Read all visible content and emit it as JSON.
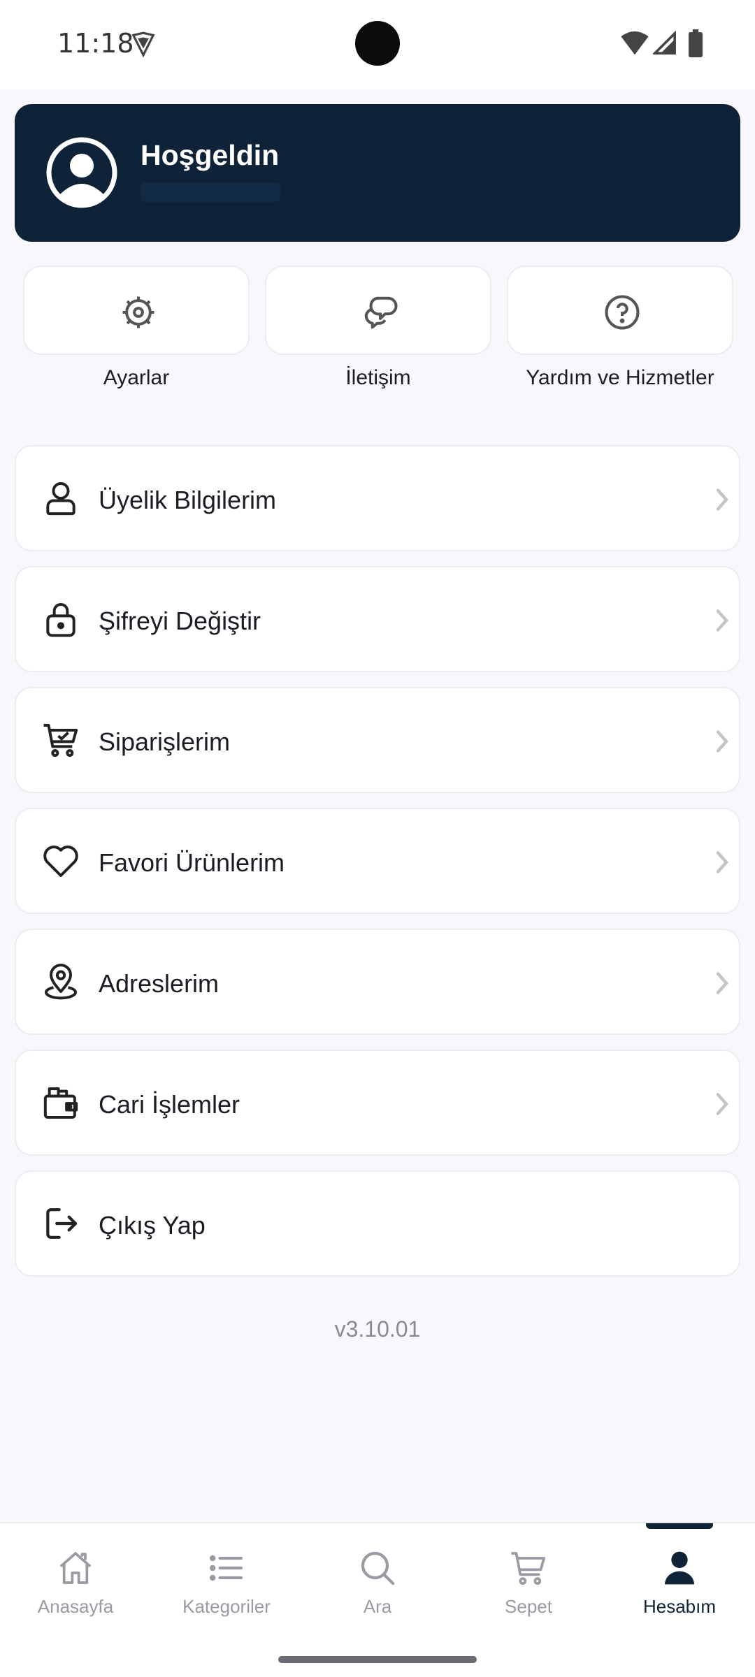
{
  "status_bar": {
    "time": "11:18"
  },
  "header": {
    "welcome_title": "Hoşgeldin"
  },
  "quick_actions": [
    {
      "label": "Ayarlar",
      "icon": "gear-icon"
    },
    {
      "label": "İletişim",
      "icon": "chat-bubbles-icon"
    },
    {
      "label": "Yardım ve Hizmetler",
      "icon": "help-circle-icon"
    }
  ],
  "menu": [
    {
      "label": "Üyelik Bilgilerim",
      "icon": "user-icon",
      "has_chevron": true
    },
    {
      "label": "Şifreyi Değiştir",
      "icon": "lock-icon",
      "has_chevron": true
    },
    {
      "label": "Siparişlerim",
      "icon": "cart-check-icon",
      "has_chevron": true
    },
    {
      "label": "Favori Ürünlerim",
      "icon": "heart-icon",
      "has_chevron": true
    },
    {
      "label": "Adreslerim",
      "icon": "location-pin-icon",
      "has_chevron": true
    },
    {
      "label": "Cari İşlemler",
      "icon": "wallet-icon",
      "has_chevron": true
    },
    {
      "label": "Çıkış Yap",
      "icon": "logout-icon",
      "has_chevron": false
    }
  ],
  "version": "v3.10.01",
  "bottom_nav": [
    {
      "label": "Anasayfa",
      "icon": "home-icon",
      "active": false
    },
    {
      "label": "Kategoriler",
      "icon": "list-icon",
      "active": false
    },
    {
      "label": "Ara",
      "icon": "search-icon",
      "active": false
    },
    {
      "label": "Sepet",
      "icon": "cart-icon",
      "active": false
    },
    {
      "label": "Hesabım",
      "icon": "account-icon",
      "active": true
    }
  ],
  "colors": {
    "primary": "#0f2338",
    "background": "#f8f7fb",
    "inactive": "#9a9aa3"
  }
}
